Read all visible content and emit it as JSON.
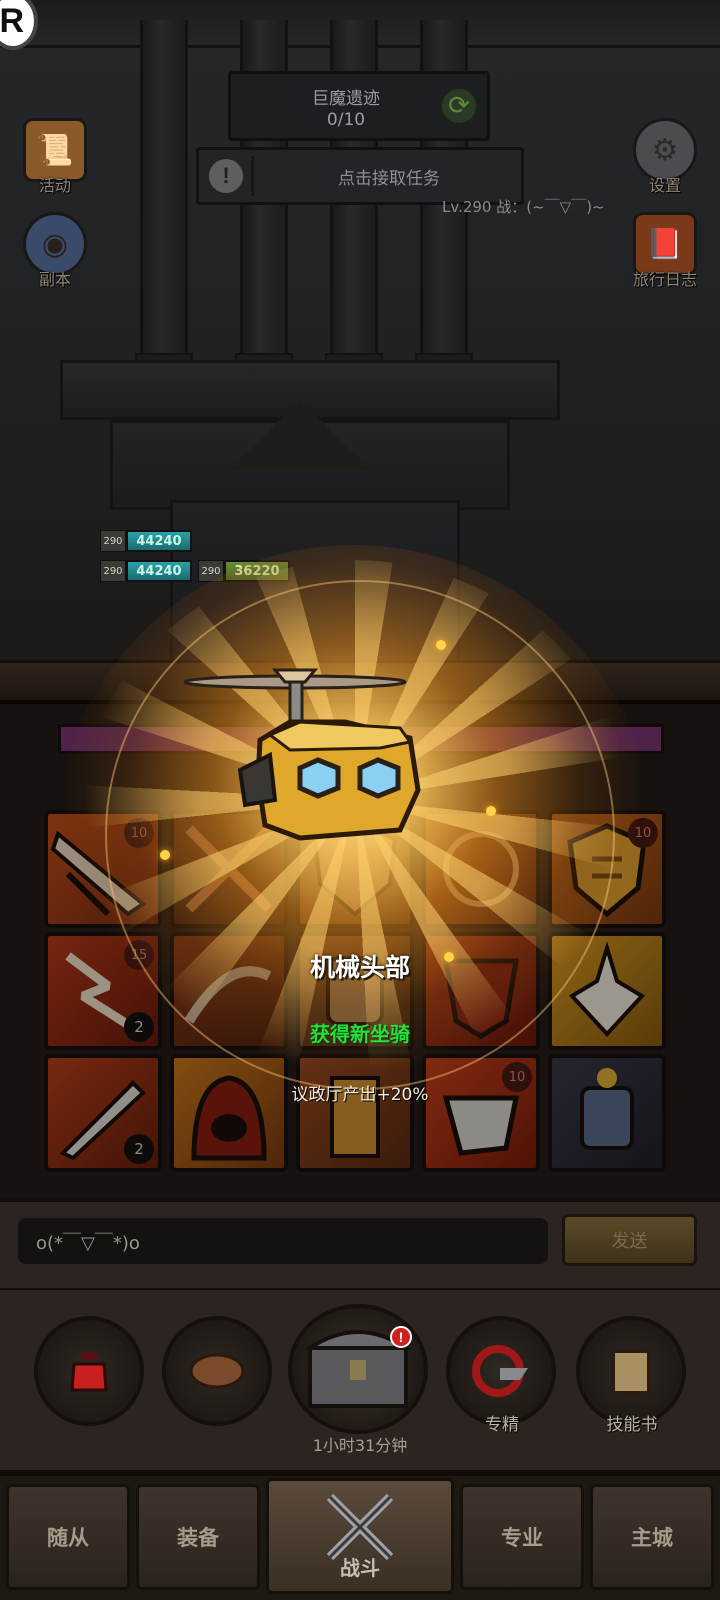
{
  "hud": {
    "badge": "R",
    "quest": {
      "title": "巨魔遗迹",
      "count": "0/10"
    },
    "task_prompt": "点击接取任务",
    "level_text": "Lv.290 战：(~￣▽￣)~",
    "left_icons": [
      {
        "label": "活动",
        "icon": "scroll-icon"
      },
      {
        "label": "副本",
        "icon": "portal-icon"
      }
    ],
    "right_icons": [
      {
        "label": "设置",
        "icon": "gear-icon"
      },
      {
        "label": "旅行日志",
        "icon": "book-icon"
      }
    ]
  },
  "party": {
    "hp_bars": [
      {
        "level": "290",
        "value": "44240"
      },
      {
        "level": "290",
        "value": "44240"
      },
      {
        "level": "290",
        "value": "36220"
      }
    ]
  },
  "reward": {
    "name": "机械头部",
    "status": "获得新坐骑",
    "bonus": "议政厅产出+20%",
    "icon": "copter-robot-head-icon"
  },
  "inventory": {
    "items": [
      {
        "icon": "blade-slash-icon",
        "level": "10",
        "count": ""
      },
      {
        "icon": "crossed-weapon-icon",
        "level": "",
        "count": ""
      },
      {
        "icon": "shield-crest-icon",
        "level": "",
        "count": ""
      },
      {
        "icon": "rune-icon",
        "level": "",
        "count": ""
      },
      {
        "icon": "golden-shield-icon",
        "level": "10",
        "count": ""
      },
      {
        "icon": "lightning-icon",
        "level": "15",
        "count": "2"
      },
      {
        "icon": "dragon-claw-icon",
        "level": "",
        "count": ""
      },
      {
        "icon": "armor-icon",
        "level": "",
        "count": ""
      },
      {
        "icon": "demon-mask-icon",
        "level": "",
        "count": ""
      },
      {
        "icon": "crown-crystal-icon",
        "level": "",
        "count": ""
      },
      {
        "icon": "dagger-icon",
        "level": "",
        "count": "2"
      },
      {
        "icon": "hood-icon",
        "level": "",
        "count": ""
      },
      {
        "icon": "helmet-icon",
        "level": "",
        "count": ""
      },
      {
        "icon": "fang-icon",
        "level": "10",
        "count": ""
      },
      {
        "icon": "knight-icon",
        "level": "",
        "count": ""
      }
    ]
  },
  "chat": {
    "input_value": "o(*￣▽￣*)o",
    "send_label": "发送"
  },
  "actions": {
    "potion": {
      "icon": "potion-icon",
      "label": ""
    },
    "bread": {
      "icon": "bread-icon",
      "label": ""
    },
    "chest": {
      "icon": "chest-icon",
      "timer": "1小时31分钟",
      "alert": "!"
    },
    "specialty": {
      "icon": "target-icon",
      "label": "专精"
    },
    "skillbook": {
      "icon": "skill-book-icon",
      "label": "技能书"
    }
  },
  "nav": {
    "tabs": [
      {
        "label": "随从"
      },
      {
        "label": "装备"
      },
      {
        "label": "战斗",
        "active": true
      },
      {
        "label": "专业"
      },
      {
        "label": "主城"
      }
    ]
  },
  "colors": {
    "reward_green": "#25e03a",
    "glow": "#ffb020",
    "bar_pink": "#7a3570"
  }
}
